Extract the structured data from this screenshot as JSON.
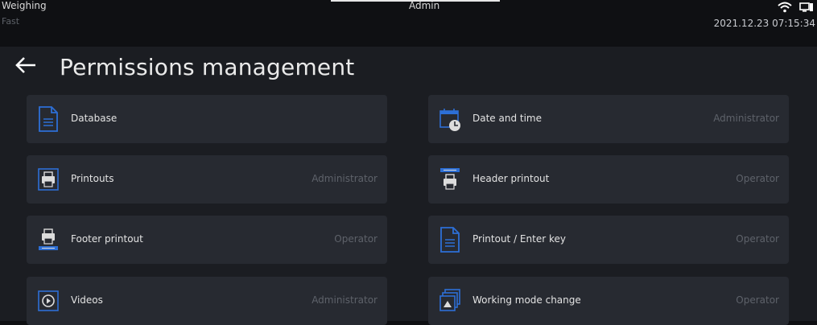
{
  "topbar": {
    "mode": "Weighing",
    "submode": "Fast",
    "user": "Admin",
    "datetime": "2021.12.23 07:15:34",
    "icons": [
      "wifi-icon",
      "pc-connection-icon"
    ]
  },
  "header": {
    "title": "Permissions management",
    "back_icon": "back-arrow-icon"
  },
  "colors": {
    "background": "#0f1013",
    "panel": "#1b1d22",
    "tile": "#272a31",
    "accent": "#2d6fd6"
  },
  "items": [
    {
      "label": "Database",
      "value": "",
      "icon": "database-icon"
    },
    {
      "label": "Date and time",
      "value": "Administrator",
      "icon": "calendar-clock-icon"
    },
    {
      "label": "Printouts",
      "value": "Administrator",
      "icon": "printouts-icon"
    },
    {
      "label": "Header printout",
      "value": "Operator",
      "icon": "header-printout-icon"
    },
    {
      "label": "Footer printout",
      "value": "Operator",
      "icon": "footer-printout-icon"
    },
    {
      "label": "Printout / Enter key",
      "value": "Operator",
      "icon": "document-icon"
    },
    {
      "label": "Videos",
      "value": "Administrator",
      "icon": "play-icon"
    },
    {
      "label": "Working mode change",
      "value": "Operator",
      "icon": "working-mode-icon"
    }
  ]
}
